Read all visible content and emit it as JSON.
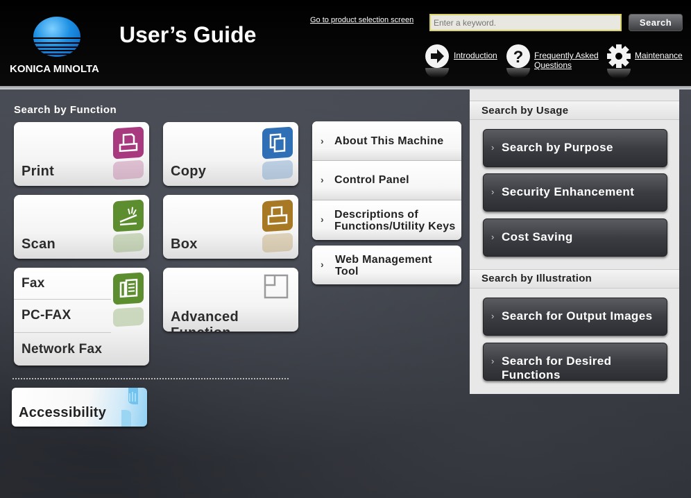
{
  "header": {
    "brand": "KONICA MINOLTA",
    "title": "User’s Guide",
    "product_link": "Go to product selection screen",
    "search_placeholder": "Enter a keyword.",
    "search_button": "Search",
    "links": [
      {
        "label": "Introduction",
        "icon": "arrow-right-icon"
      },
      {
        "label": "Frequently Asked\nQuestions",
        "icon": "question-icon"
      },
      {
        "label": "Maintenance",
        "icon": "gear-icon"
      }
    ]
  },
  "search_by_function": {
    "title": "Search by Function",
    "tiles": [
      {
        "label": "Print",
        "icon": "print-icon",
        "color": "#a8397f"
      },
      {
        "label": "Copy",
        "icon": "copy-icon",
        "color": "#2f6fb6"
      },
      {
        "label": "Scan",
        "icon": "scan-icon",
        "color": "#5c8d2f"
      },
      {
        "label": "Box",
        "icon": "box-icon",
        "color": "#a77925"
      },
      {
        "labels": [
          "Fax",
          "PC-FAX",
          "Network Fax"
        ],
        "icon": "fax-icon",
        "color": "#5c8d2f"
      },
      {
        "label": "Advanced Function",
        "icon": "advanced-function-icon",
        "color": "#9a9a9a"
      }
    ]
  },
  "middle_list": [
    {
      "label": "About This Machine"
    },
    {
      "label": "Control Panel"
    },
    {
      "label": "Descriptions of\nFunctions/Utility Keys"
    }
  ],
  "web_management": {
    "label": "Web Management\nTool"
  },
  "accessibility": {
    "label": "Accessibility",
    "color": "#8fd0f3"
  },
  "search_by_usage": {
    "title": "Search by Usage",
    "buttons": [
      "Search by Purpose",
      "Security Enhancement",
      "Cost Saving"
    ]
  },
  "search_by_illustration": {
    "title": "Search by Illustration",
    "buttons": [
      "Search for Output Images",
      "Search for Desired Functions"
    ]
  }
}
